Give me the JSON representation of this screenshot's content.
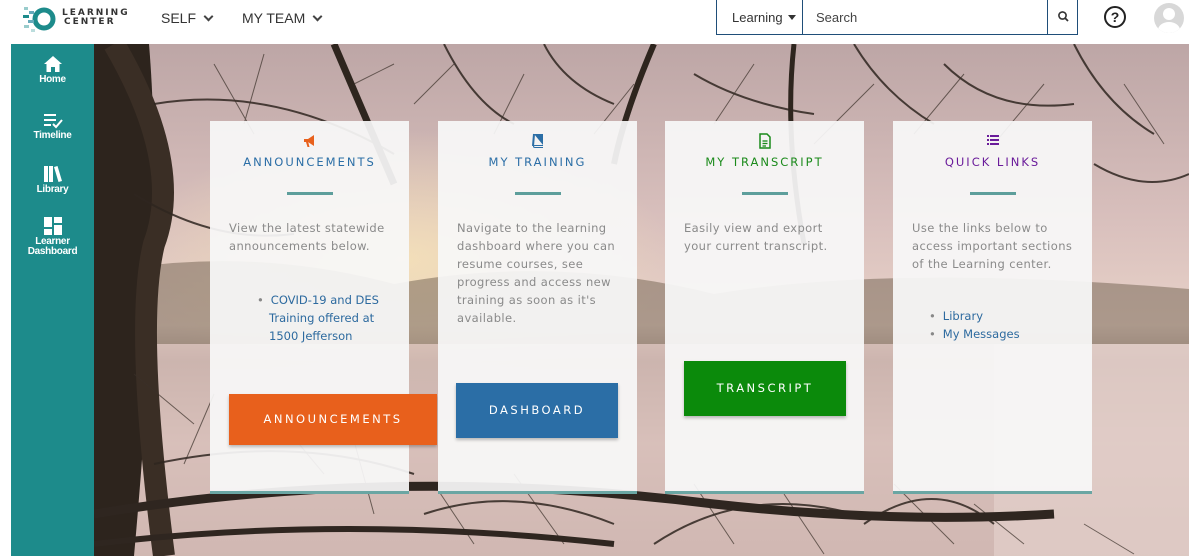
{
  "header": {
    "logo_text_line1": "LEARNING",
    "logo_text_line2": "CENTER",
    "nav": [
      {
        "label": "SELF",
        "icon": "chevron-down-icon"
      },
      {
        "label": "MY TEAM",
        "icon": "chevron-down-icon"
      }
    ],
    "search": {
      "category": "Learning",
      "placeholder": "Search",
      "value": "",
      "button_icon": "search-icon"
    },
    "help_glyph": "?",
    "help_icon": "help-circle-icon",
    "avatar_icon": "user-avatar-icon"
  },
  "sidebar": {
    "items": [
      {
        "label": "Home",
        "icon": "home-icon"
      },
      {
        "label": "Timeline",
        "icon": "timeline-icon"
      },
      {
        "label": "Library",
        "icon": "library-icon"
      },
      {
        "label": "Learner Dashboard",
        "label_line1": "Learner",
        "label_line2": "Dashboard",
        "icon": "dashboard-icon"
      }
    ]
  },
  "cards": [
    {
      "title": "ANNOUNCEMENTS",
      "icon": "megaphone-icon",
      "description": "View the latest statewide announcements below.",
      "links": [
        "COVID-19 and DES Training offered at 1500 Jefferson"
      ],
      "button": "ANNOUNCEMENTS"
    },
    {
      "title": "MY TRAINING",
      "icon": "book-icon",
      "description": "Navigate to the learning dashboard where you can resume courses, see progress and access new training as soon as it's available.",
      "button": "DASHBOARD"
    },
    {
      "title": "MY TRANSCRIPT",
      "icon": "document-icon",
      "description": "Easily view and export your current transcript.",
      "button": "TRANSCRIPT"
    },
    {
      "title": "QUICK LINKS",
      "icon": "list-icon",
      "description": "Use the links below to access important sections of the Learning center.",
      "links": [
        "Library",
        "My Messages"
      ]
    }
  ],
  "colors": {
    "sidebar": "#1d8b8b",
    "announcements_accent": "#e8601c",
    "training_accent": "#2b6ea6",
    "transcript_accent": "#1a8a1a",
    "quicklinks_accent": "#6a1b9a",
    "announcements_button": "#e8601c",
    "dashboard_button": "#2b6ea6",
    "transcript_button": "#0b8a0b",
    "card_rule": "#5d9e9b"
  }
}
